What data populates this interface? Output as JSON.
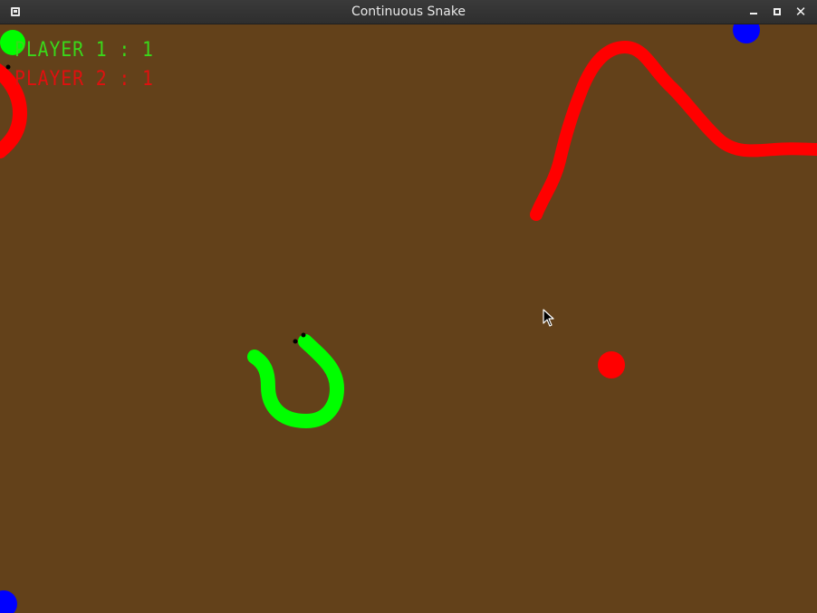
{
  "window": {
    "title": "Continuous Snake",
    "buttons": {
      "minimize": "minimize",
      "maximize": "maximize",
      "close": "✕"
    }
  },
  "scores": {
    "player1": "PLAYER 1 : 1",
    "player2": "PLAYER 2 : 1"
  },
  "colors": {
    "background": "#63411a",
    "player1": "#00ff00",
    "player2": "#ff0000",
    "neutral_orb": "#0000ff"
  },
  "entities": {
    "player1_snake": "green-snake",
    "player2_snake": "red-snake",
    "orbs": [
      "green-orb",
      "red-orb",
      "blue-orb",
      "blue-orb"
    ]
  }
}
